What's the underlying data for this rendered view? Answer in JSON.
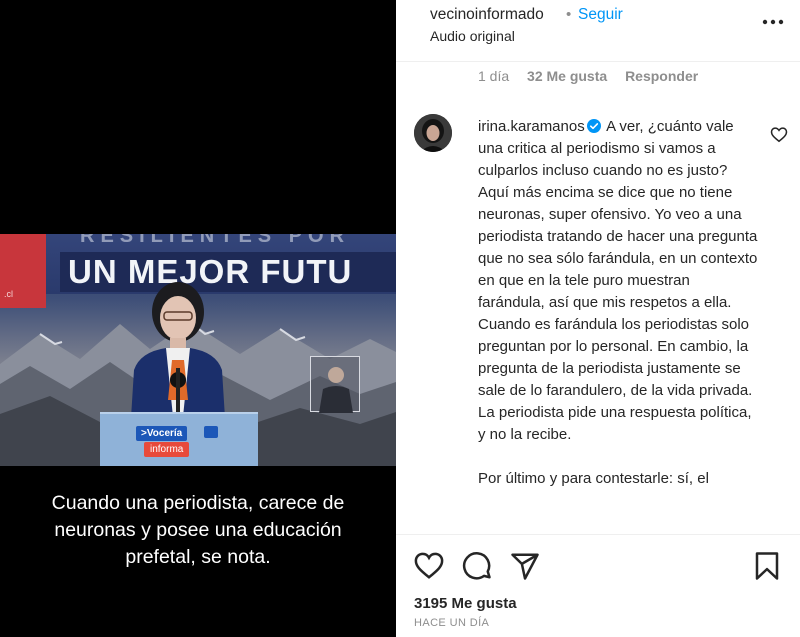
{
  "video": {
    "banner_top": "RESILIENTES POR",
    "banner_main": "UN MEJOR FUTU",
    "red_block_text": ".cl",
    "podium_badge_top": ">Vocería",
    "podium_badge_bottom": "informa",
    "caption_lines": [
      "Cuando una periodista, carece de",
      "neuronas y posee una educación",
      "prefetal, se nota."
    ]
  },
  "post": {
    "username": "vecinoinformado",
    "separator": "•",
    "follow_label": "Seguir",
    "audio_label": "Audio original",
    "more_icon": "more-horizontal-icon"
  },
  "comment_meta": {
    "time": "1 día",
    "likes": "32 Me gusta",
    "reply": "Responder"
  },
  "comment": {
    "author": "irina.karamanos",
    "text": "A ver, ¿cuánto vale una critica al periodismo si vamos a culparlos incluso cuando no es justo? Aquí más encima se dice que no tiene neuronas, super ofensivo. Yo veo a una periodista tratando de hacer una pregunta que no sea sólo farándula, en un contexto en que en la tele puro muestran farándula, así que mis respetos a ella. Cuando es farándula los periodistas solo preguntan por lo personal. En cambio, la pregunta de la periodista justamente se sale de lo farandulero, de la vida privada. La periodista pide una respuesta política, y no la recibe.",
    "text_2": "Por último y para contestarle: sí, el"
  },
  "footer": {
    "likes_count": "3195 Me gusta",
    "time_ago": "HACE UN DÍA"
  },
  "colors": {
    "follow": "#0095f6",
    "verified": "#0095f6",
    "muted": "#8e8e8e",
    "text": "#262626"
  }
}
